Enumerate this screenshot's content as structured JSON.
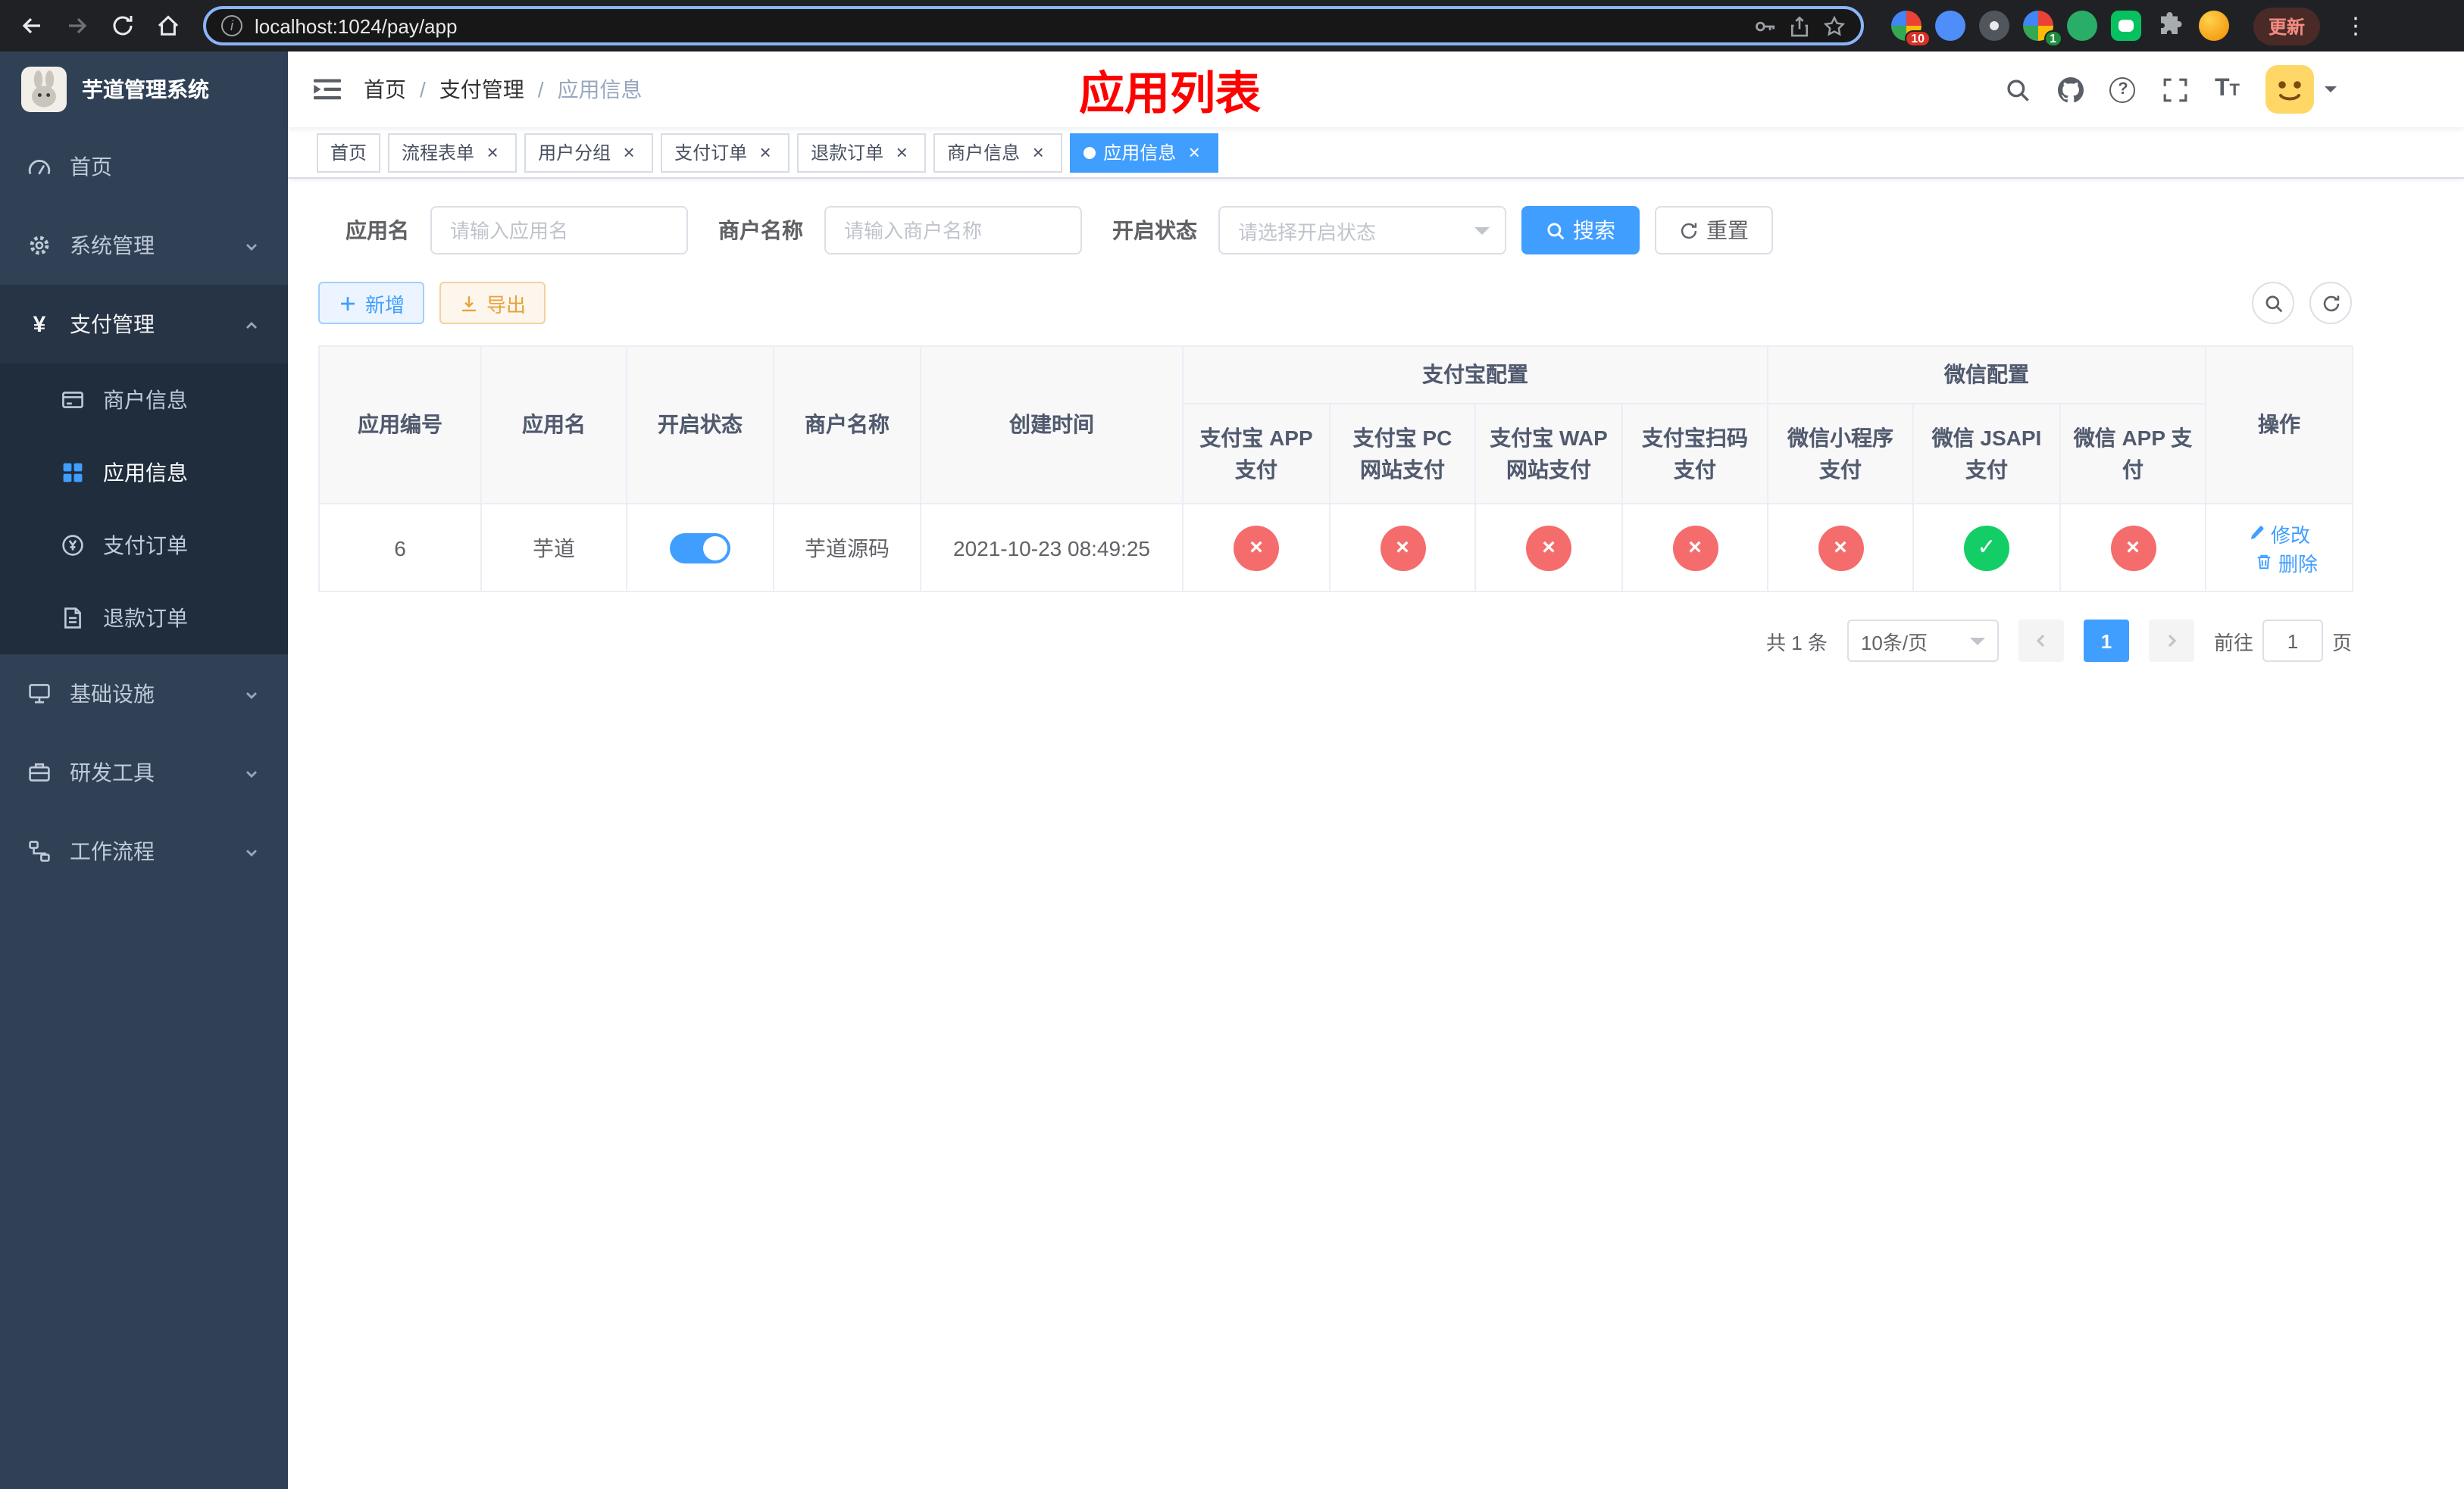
{
  "browser": {
    "url": "localhost:1024/pay/app",
    "update_button": "更新",
    "ext_badge_a": "10",
    "ext_badge_b": "1"
  },
  "sidebar": {
    "logo_title": "芋道管理系统",
    "menu": [
      {
        "label": "首页"
      },
      {
        "label": "系统管理"
      },
      {
        "label": "支付管理"
      },
      {
        "label": "基础设施"
      },
      {
        "label": "研发工具"
      },
      {
        "label": "工作流程"
      }
    ],
    "submenu": [
      {
        "label": "商户信息"
      },
      {
        "label": "应用信息",
        "active": true
      },
      {
        "label": "支付订单"
      },
      {
        "label": "退款订单"
      }
    ]
  },
  "navbar": {
    "breadcrumb": [
      "首页",
      "支付管理",
      "应用信息"
    ],
    "separator": "/",
    "annotation": "应用列表"
  },
  "tabs": [
    {
      "label": "首页",
      "closable": false
    },
    {
      "label": "流程表单",
      "closable": true
    },
    {
      "label": "用户分组",
      "closable": true
    },
    {
      "label": "支付订单",
      "closable": true
    },
    {
      "label": "退款订单",
      "closable": true
    },
    {
      "label": "商户信息",
      "closable": true
    },
    {
      "label": "应用信息",
      "closable": true,
      "active": true
    }
  ],
  "filters": {
    "app_name_label": "应用名",
    "app_name_placeholder": "请输入应用名",
    "merchant_label": "商户名称",
    "merchant_placeholder": "请输入商户名称",
    "status_label": "开启状态",
    "status_placeholder": "请选择开启状态",
    "search_button": "搜索",
    "reset_button": "重置"
  },
  "toolbar": {
    "add_button": "新增",
    "export_button": "导出"
  },
  "table": {
    "columns": {
      "app_id": "应用编号",
      "app_name": "应用名",
      "status": "开启状态",
      "merchant": "商户名称",
      "created": "创建时间",
      "alipay_group": "支付宝配置",
      "wechat_group": "微信配置",
      "actions": "操作"
    },
    "sub_columns": [
      "支付宝 APP 支付",
      "支付宝 PC 网站支付",
      "支付宝 WAP 网站支付",
      "支付宝扫码支付",
      "微信小程序支付",
      "微信 JSAPI 支付",
      "微信 APP 支付"
    ],
    "row": {
      "app_id": "6",
      "app_name": "芋道",
      "status": "on",
      "merchant": "芋道源码",
      "created": "2021-10-23 08:49:25",
      "channels": [
        "disabled",
        "disabled",
        "disabled",
        "disabled",
        "disabled",
        "enabled",
        "disabled"
      ],
      "edit_link": "修改",
      "delete_link": "删除"
    }
  },
  "pagination": {
    "total": "共 1 条",
    "page_size": "10条/页",
    "page": "1",
    "goto_prefix": "前往",
    "goto_value": "1",
    "goto_suffix": "页"
  }
}
